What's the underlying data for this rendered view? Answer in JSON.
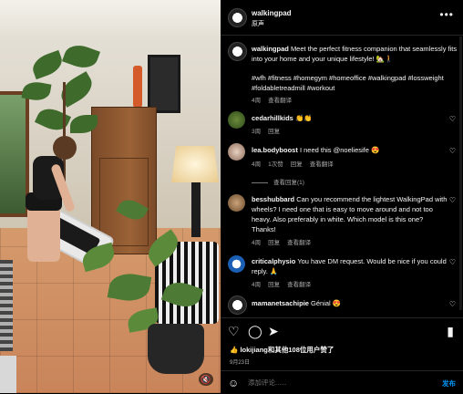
{
  "post_author": {
    "username": "walkingpad",
    "audio": "原声"
  },
  "caption": {
    "username": "walkingpad",
    "text": "Meet the perfect fitness companion that seamlessly fits into your home and your unique lifestyle! 🏡🚶",
    "hashtags": "#wfh #fitness #homegym #homeoffice #walkingpad #lossweight #foldabletreadmill #workout",
    "time": "4周",
    "see_translation": "查看翻译"
  },
  "comments": [
    {
      "username": "cedarhillkids",
      "text": "👏👏",
      "time": "3周",
      "reply": "回复"
    },
    {
      "username": "lea.bodyboost",
      "text": "I need this @noeliesife 😍",
      "time": "4周",
      "likes": "1次赞",
      "reply": "回复",
      "see_translation": "查看翻译"
    },
    {
      "username": "besshubbard",
      "text": "Can you recommend the lightest WalkingPad with wheels? I need one that is easy to move around and not too heavy. Also preferably in white. Which model is this one? Thanks!",
      "time": "4周",
      "reply": "回复",
      "see_translation": "查看翻译"
    },
    {
      "username": "criticalphysio",
      "text": "You have DM request. Would be nice if you could reply. 🙏",
      "time": "4周",
      "reply": "回复",
      "see_translation": "查看翻译"
    },
    {
      "username": "mamanetsachipie",
      "text": "Génial 😍"
    }
  ],
  "view_replies": "查看回复(1)",
  "likes_line": "lokijiang和其他108位用户赞了",
  "date": "9月23日",
  "add_comment": {
    "placeholder": "添加评论......",
    "post_label": "发布"
  }
}
